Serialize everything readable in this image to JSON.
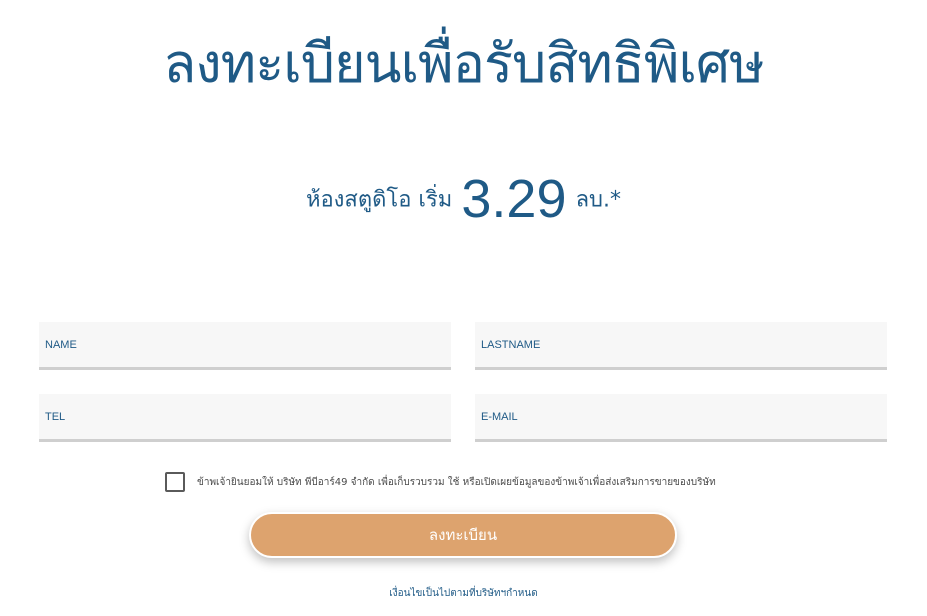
{
  "headline": "ลงทะเบียนเพื่อรับสิทธิพิเศษ",
  "price_line": {
    "prefix": "ห้องสตูดิโอ เริ่ม",
    "price": "3.29",
    "suffix": "ลบ.*"
  },
  "form": {
    "name_placeholder": "NAME",
    "lastname_placeholder": "LASTNAME",
    "tel_placeholder": "TEL",
    "email_placeholder": "E-MAIL",
    "name_value": "",
    "lastname_value": "",
    "tel_value": "",
    "email_value": "",
    "consent_checked": false,
    "consent_text": "ข้าพเจ้ายินยอมให้ บริษัท พีบีอาร์49 จำกัด เพื่อเก็บรวบรวม ใช้ หรือเปิดเผยข้อมูลของข้าพเจ้าเพื่อส่งเสริมการขายของบริษัท",
    "submit_label": "ลงทะเบียน"
  },
  "conditions": "เงื่อนไขเป็นไปตามที่บริษัทฯกำหนด",
  "colors": {
    "primary": "#1f5a86",
    "button": "#dda36e",
    "field_bg": "#f7f7f7",
    "field_border": "#cfcfcf"
  }
}
